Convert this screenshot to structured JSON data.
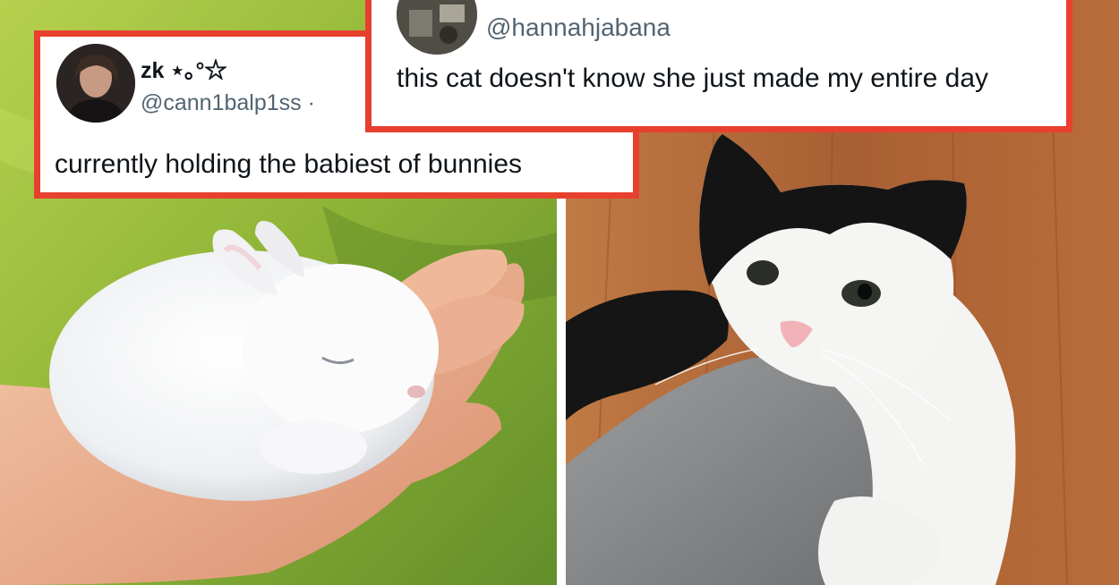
{
  "left_tweet": {
    "display_name": "zk ⋆｡°☆",
    "handle": "@cann1balp1ss ·",
    "text": "currently holding the babiest of bunnies"
  },
  "right_tweet": {
    "handle": "@hannahjabana",
    "text": "this cat doesn't know she just made my entire day"
  },
  "colors": {
    "frame_border": "#e8402f",
    "grass": "#9cbf3c",
    "floor": "#b0663a",
    "handle_text": "#536471"
  },
  "photos": {
    "left": "bunny-in-hand-photo",
    "right": "cat-on-knee-photo"
  }
}
